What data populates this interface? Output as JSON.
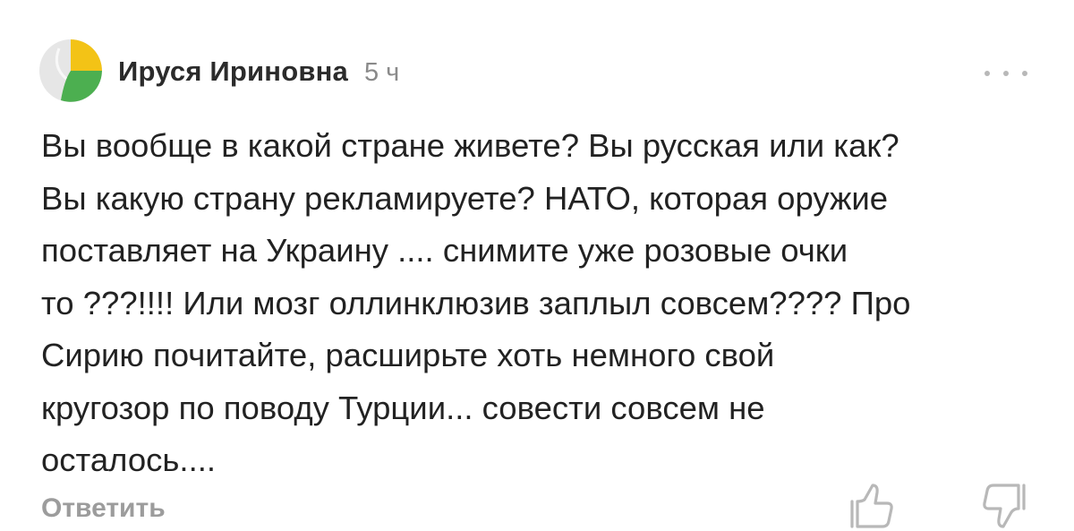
{
  "comment": {
    "author": "Ируся Ириновна",
    "time": "5 ч",
    "text": "Вы вообще в какой стране живете? Вы русская или как?\nВы какую страну рекламируете? НАТО, которая оружие\nпоставляет на Украину .... снимите уже розовые очки\nто ???!!!! Или мозг оллинклюзив заплыл совсем???? Про\nСирию почитайте, расширьте хоть немного свой\nкругозор по поводу Турции... совести совсем не\nосталось....",
    "reply_label": "Ответить",
    "icons": {
      "avatar": "leaf-avatar-icon",
      "more": "more-dots-icon",
      "like": "thumbs-up-icon",
      "dislike": "thumbs-down-icon"
    },
    "colors": {
      "avatar_yellow": "#f3c316",
      "avatar_green": "#4caf50",
      "avatar_grey": "#e6e6e6",
      "muted_text": "#9c9c9c"
    }
  }
}
